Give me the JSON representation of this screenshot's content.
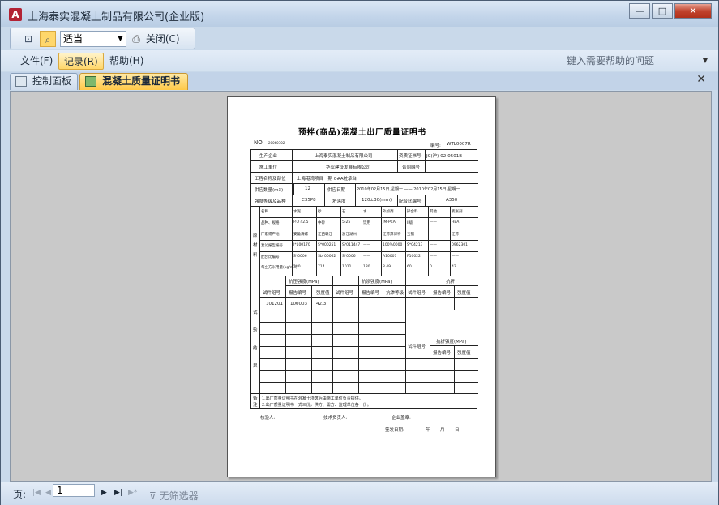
{
  "window": {
    "title": "上海泰实混凝土制品有限公司(企业版)",
    "app_icon": "A",
    "buttons": {
      "minimize": "—",
      "maximize": "□",
      "close": "✕"
    }
  },
  "toolbar": {
    "zoom_value": "适当",
    "close_label": "关闭(C)"
  },
  "menu": {
    "items": [
      "文件(F)",
      "记录(R)",
      "帮助(H)"
    ],
    "help_placeholder": "键入需要帮助的问题"
  },
  "tabs": [
    {
      "label": "控制面板"
    },
    {
      "label": "混凝土质量证明书"
    }
  ],
  "report": {
    "title": "预拌(商品)混凝土出厂质量证明书",
    "no_label": "NO.",
    "no_value": "20060702",
    "serial_label": "编号:",
    "serial_value": "WTL0007R",
    "rows": {
      "producer_label": "生产企业",
      "producer_value": "上海泰实混凝土制品有限公司",
      "qual_label": "资质证书号",
      "qual_value": "JC(沪)-02-0501B",
      "builder_label": "施工单位",
      "builder_value": "华业建设发展有限公司",
      "contract_label": "合同编号",
      "project_label": "工程名称及部位",
      "project_value": "上海港湾项目一期  0#A桩承台",
      "volume_label": "供应数量(m3)",
      "volume_value": "12",
      "date_label": "供应日期",
      "date_value": "2010年02月15日,星期一 —— 2010年02月15日,星期一",
      "grade_label": "强度等级及品种",
      "grade_value": "C35P8",
      "slump_label": "坍落度",
      "slump_value": "120±30(mm)",
      "mix_label": "配合比编号",
      "mix_value": "A350"
    },
    "materials": {
      "side_label": "原材料",
      "headers": [
        "名称",
        "水泥",
        "砂",
        "石",
        "水",
        "外加剂",
        "掺合料",
        "其他",
        "膨胀剂"
      ],
      "rows": [
        [
          "品种、规格",
          "P.O 42.5",
          "中砂",
          "5-25",
          "饮用",
          "JM-PCA",
          "II级",
          "——",
          "HEA"
        ],
        [
          "厂家或产地",
          "安徽海螺",
          "江西赣江",
          "浙江湖州",
          "——",
          "江苏苏博特",
          "宝钢",
          "——",
          "江苏"
        ],
        [
          "复试报告编号",
          "J*100170",
          "S*000251",
          "S*011447",
          "——",
          "100%0000",
          "S*04213",
          "——",
          "0962301"
        ],
        [
          "配合比编号",
          "S*0006",
          "Sb*00062",
          "S*0006",
          "——",
          "A10007",
          "F10022",
          "——",
          "——"
        ],
        [
          "每立方米用量(kg/m3)",
          "280",
          "714",
          "1011",
          "180",
          "8.49",
          "60",
          "0",
          "42"
        ]
      ]
    },
    "tests": {
      "strength_header": "抗压强度(MPa)",
      "perm_header": "抗渗强度(MPa)",
      "other_header": "抗折",
      "side_labels": [
        "试",
        "验",
        "结",
        "果"
      ],
      "group_label": "试件组号",
      "report_label": "报告编号",
      "value_label": "强度值",
      "grade_label": "抗渗等级",
      "flex_header": "抗折强度(MPa)",
      "entry": [
        "101201",
        "100003",
        "42.3"
      ]
    },
    "notes_label": "备注",
    "notes": [
      "1.出厂质量证明书在混凝土浇筑后由施工单位负责提供。",
      "2.出厂质量证明书一式三份，供方、需方、监理单位各一份。"
    ],
    "sign": [
      "核验人:",
      "技术负责人:",
      "企业盖章:",
      "签发日期:",
      "年",
      "月",
      "日"
    ]
  },
  "statusbar": {
    "record_label": "页:",
    "record_value": "1",
    "filter_label": "无筛选器"
  }
}
